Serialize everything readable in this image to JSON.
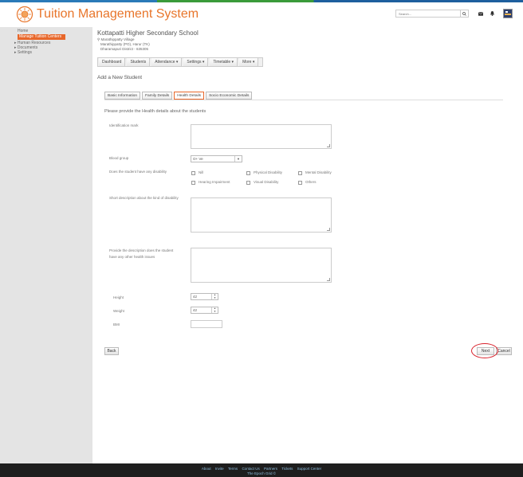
{
  "header": {
    "app_title": "Tuition Management System",
    "search_placeholder": "Search..."
  },
  "sidebar": {
    "home": "Home",
    "active_item": "Manage Tuition Centers",
    "items": [
      "Human Resources",
      "Documents",
      "Settings"
    ]
  },
  "school": {
    "name": "Kottapatti Higher Secondary School",
    "address_line1": "Marathippatty Village",
    "address_line2": "Marathippatty (PO), Harur (TK)",
    "address_line3": "Dharamapuri District - 635305"
  },
  "menu": [
    "Dashboard",
    "Students",
    "Attendance ▾",
    "Settings ▾",
    "Timetable ▾",
    "More ▾"
  ],
  "page_title": "Add a New Student",
  "tabs": [
    "Basic Information",
    "Family Details",
    "Health Details",
    "Socio Economic Details"
  ],
  "active_tab": "Health Details",
  "form": {
    "intro": "Please provide the Health details about the students",
    "identification_label": "Identification mark",
    "blood_group_label": "Blood group",
    "blood_group_value": "O+ Ve",
    "disability_label": "Does the student have any disability",
    "disability_options": [
      "Nill",
      "Physical Disability",
      "Mental Disability",
      "Hearing Impairment",
      "Visual Disability",
      "Others"
    ],
    "disability_desc_label": "Short description about the kind of disability",
    "health_issues_label": "Provide the description does the student have any other health issues",
    "height_label": "Height",
    "height_value": "42",
    "weight_label": "Weight",
    "weight_value": "42",
    "bmi_label": "BMI"
  },
  "buttons": {
    "back": "Back",
    "next": "Next",
    "cancel": "Cancel"
  },
  "footer": {
    "links": [
      "About",
      "Invite",
      "Terms",
      "Contact Us",
      "Partners",
      "Tickets",
      "Support Center"
    ],
    "copyright": "The Epoch Grid ©"
  },
  "colors": {
    "brand_orange": "#e8752a",
    "sidebar_active": "#e8672a",
    "highlight_circle": "#d9232d"
  }
}
